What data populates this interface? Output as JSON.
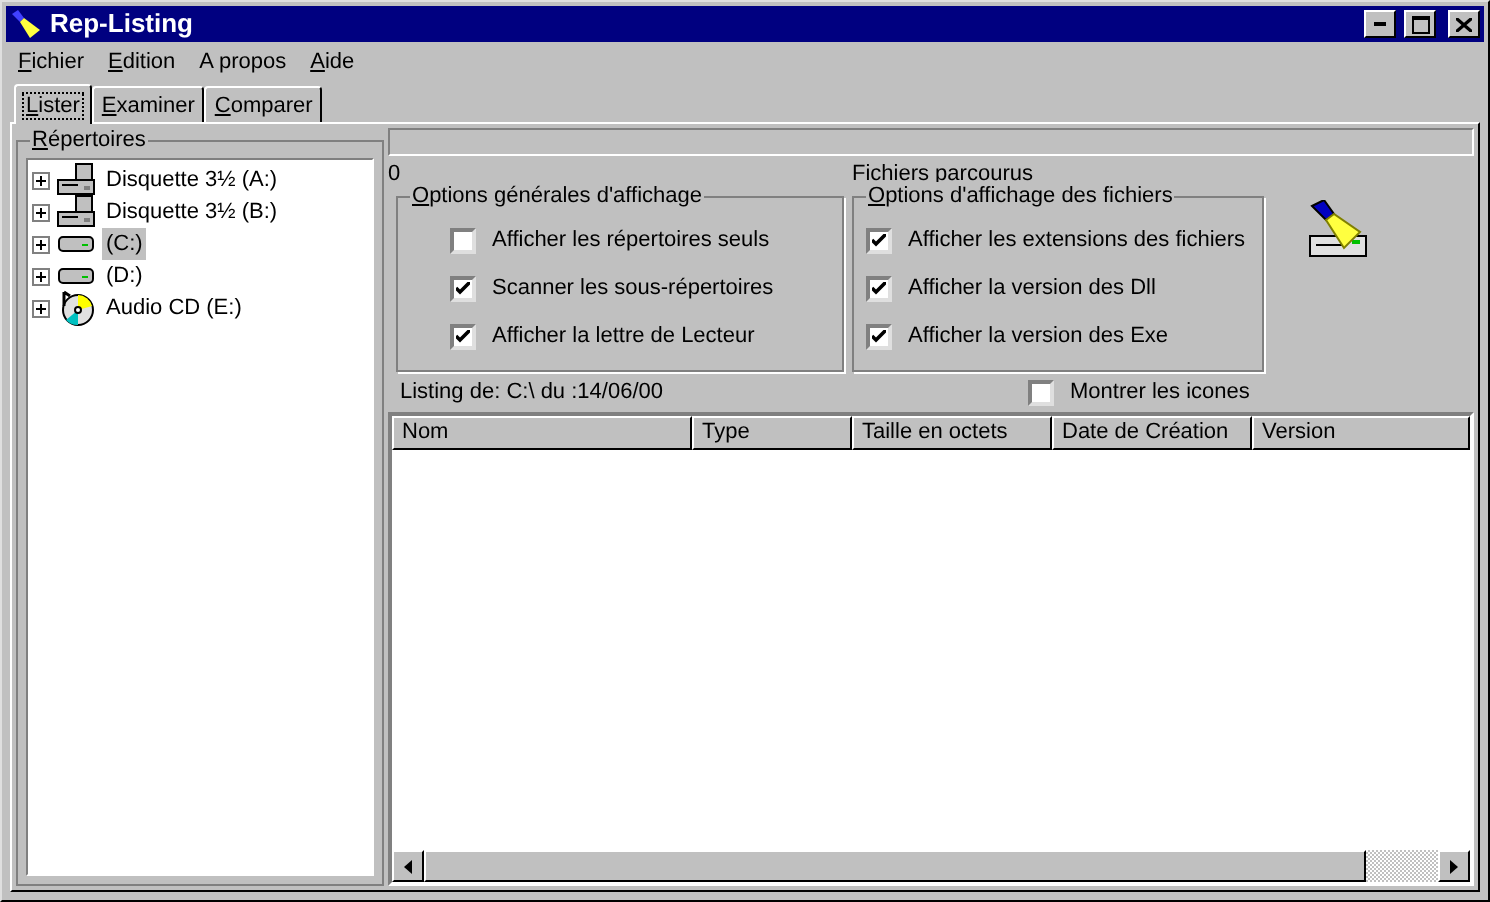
{
  "window": {
    "title": "Rep-Listing"
  },
  "menu": [
    {
      "label": "Fichier",
      "underline_first": true
    },
    {
      "label": "Edition",
      "underline_first": true
    },
    {
      "label": "A propos",
      "underline_first": false
    },
    {
      "label": "Aide",
      "underline_first": true
    }
  ],
  "tabs": [
    {
      "label": "Lister",
      "selected": true
    },
    {
      "label": "Examiner",
      "selected": false
    },
    {
      "label": "Comparer",
      "selected": false
    }
  ],
  "tree": {
    "title": "Répertoires",
    "items": [
      {
        "label": "Disquette 3½ (A:)",
        "kind": "floppy",
        "selected": false
      },
      {
        "label": "Disquette 3½ (B:)",
        "kind": "floppy",
        "selected": false
      },
      {
        "label": "(C:)",
        "kind": "drive",
        "selected": true
      },
      {
        "label": "(D:)",
        "kind": "drive",
        "selected": false
      },
      {
        "label": "Audio CD (E:)",
        "kind": "cd",
        "selected": false
      }
    ]
  },
  "counter": "0",
  "files_label": "Fichiers parcourus",
  "general_options": {
    "title": "Options générales d'affichage",
    "items": [
      {
        "label": "Afficher les répertoires seuls",
        "checked": false
      },
      {
        "label": "Scanner les sous-répertoires",
        "checked": true
      },
      {
        "label": "Afficher la lettre de Lecteur",
        "checked": true
      }
    ]
  },
  "file_options": {
    "title": "Options d'affichage des fichiers",
    "items": [
      {
        "label": "Afficher les extensions des fichiers",
        "checked": true
      },
      {
        "label": "Afficher la version des Dll",
        "checked": true
      },
      {
        "label": "Afficher la version des Exe",
        "checked": true
      }
    ]
  },
  "listing_info": "Listing de: C:\\ du :14/06/00",
  "show_icons": {
    "label": "Montrer les icones",
    "checked": false
  },
  "table": {
    "columns": [
      "Nom",
      "Type",
      "Taille en octets",
      "Date de Création",
      "Version"
    ]
  }
}
